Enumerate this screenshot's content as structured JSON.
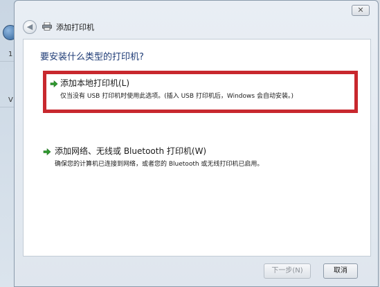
{
  "background": {
    "strip_labels": [
      "1",
      "V"
    ]
  },
  "dialog": {
    "title": "添加打印机",
    "close_label": "✕",
    "back_label": "◀"
  },
  "content": {
    "heading": "要安装什么类型的打印机?",
    "options": [
      {
        "title": "添加本地打印机(L)",
        "description": "仅当没有 USB 打印机时使用此选项。(插入 USB 打印机后，Windows 会自动安装。)"
      },
      {
        "title": "添加网络、无线或 Bluetooth 打印机(W)",
        "description": "确保您的计算机已连接到网络，或者您的 Bluetooth 或无线打印机已启用。"
      }
    ]
  },
  "footer": {
    "next_label": "下一步(N)",
    "cancel_label": "取消"
  },
  "colors": {
    "highlight_border": "#c8282e",
    "heading_text": "#1e3b76",
    "arrow_green": "#2e9a2e"
  }
}
